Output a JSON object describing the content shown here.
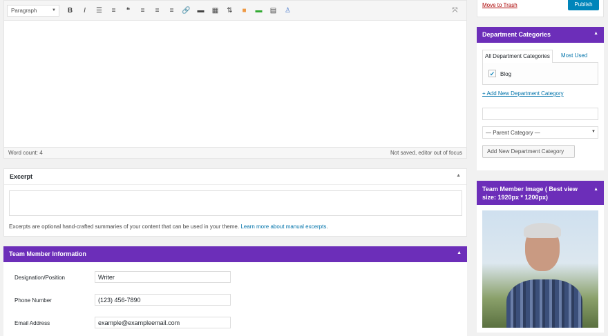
{
  "toolbar": {
    "format": "Paragraph",
    "icons": [
      "bold-icon",
      "italic-icon",
      "bullet-list-icon",
      "numbered-list-icon",
      "blockquote-icon",
      "align-left-icon",
      "align-center-icon",
      "align-right-icon",
      "link-icon",
      "read-more-icon",
      "toolbar-toggle-icon",
      "shortcode-icon",
      "color-grid-icon",
      "divider-icon",
      "table-icon",
      "lock-icon"
    ],
    "glyphs": [
      "B",
      "I",
      "☰",
      "≡",
      "❝",
      "≡",
      "≡",
      "≡",
      "🔗",
      "▬",
      "▦",
      "⇅",
      "■",
      "▬",
      "▤",
      "♙"
    ]
  },
  "editor": {
    "word_count": "Word count: 4",
    "save_status": "Not saved, editor out of focus"
  },
  "excerpt": {
    "title": "Excerpt",
    "help": "Excerpts are optional hand-crafted summaries of your content that can be used in your theme.",
    "link": "Learn more about manual excerpts",
    "period": "."
  },
  "team_info": {
    "title": "Team Member Information",
    "fields": [
      {
        "label": "Designation/Position",
        "value": "Writer"
      },
      {
        "label": "Phone Number",
        "value": "(123) 456-7890"
      },
      {
        "label": "Email Address",
        "value": "example@exampleemail.com"
      }
    ]
  },
  "publish": {
    "trash": "Move to Trash",
    "publish": "Publish"
  },
  "dept": {
    "title": "Department Categories",
    "tab_all": "All Department Categories",
    "tab_used": "Most Used",
    "category": "Blog",
    "add_link": "+ Add New Department Category",
    "parent": "— Parent Category —",
    "add_button": "Add New Department Category"
  },
  "image_box": {
    "title": "Team Member Image ( Best view size: 1920px * 1200px)"
  },
  "colors": {
    "accent": "#6c2eb9",
    "link": "#0073aa",
    "publish": "#0085ba"
  }
}
